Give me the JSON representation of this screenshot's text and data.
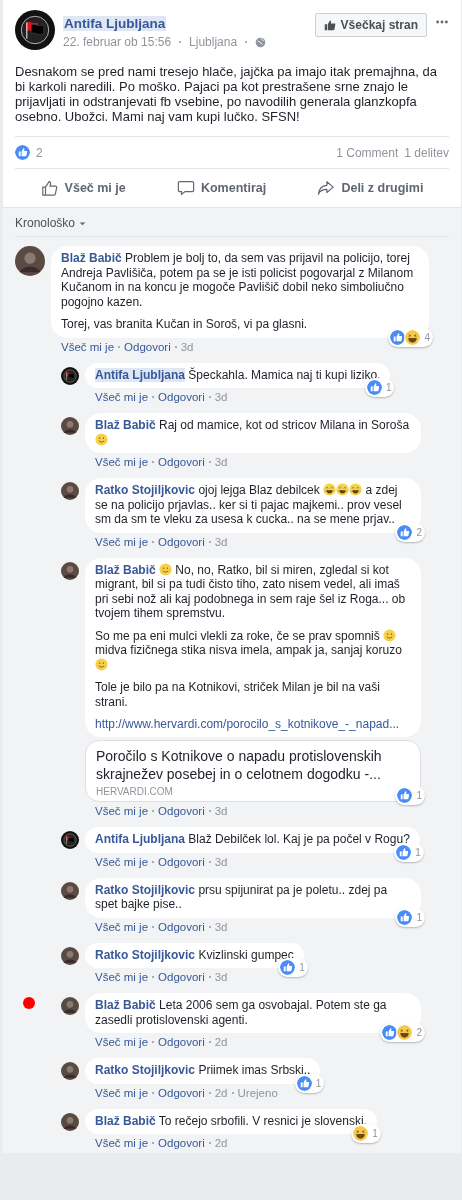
{
  "post": {
    "author": "Antifa Ljubljana",
    "author_highlighted": true,
    "date": "22. februar ob 15:56",
    "location": "Ljubljana",
    "like_page_button": "Všečkaj stran",
    "text": "Desnakom se pred nami tresejo hlače, jajčka pa imajo itak premajhna, da bi karkoli naredili. Po moško. Pajaci pa kot prestrašene srne znajo le prijavljati in odstranjevati fb vsebine, po navodilih generala glanzkopfa osebno. Ubožci. Mami naj vam kupi lučko. SFSN!",
    "reaction_count": "2",
    "comments_count": "1 Comment",
    "shares_count": "1 delitev",
    "actions": [
      {
        "kind": "like",
        "label": "Všeč mi je"
      },
      {
        "kind": "comment",
        "label": "Komentiraj"
      },
      {
        "kind": "share",
        "label": "Deli z drugimi"
      }
    ],
    "sort_label": "Kronološko"
  },
  "comments": [
    {
      "author": "Blaž Babič",
      "avatar": {
        "kind": "photo"
      },
      "paragraphs": [
        [
          {
            "kind": "text",
            "text": "Problem je bolj to, da sem vas prijavil na policijo, torej Andreja Pavlišiča, potem pa se je isti policist pogovarjal z Milanom Kučanom in na koncu je mogoče Pavlišič dobil neko simboliučno pogojno kazen."
          }
        ],
        [
          {
            "kind": "text",
            "text": "Torej, vas branita Kučan in Soroš, vi pa glasni."
          }
        ]
      ],
      "reactions": {
        "types": [
          {
            "kind": "like"
          },
          {
            "kind": "haha"
          }
        ],
        "count": "4"
      },
      "like_label": "Všeč mi je",
      "reply_label": "Odgovori",
      "time": "3d",
      "replies": [
        {
          "author": "Antifa Ljubljana",
          "author_highlighted": true,
          "avatar": {
            "kind": "antifa"
          },
          "paragraphs": [
            [
              {
                "kind": "text",
                "text": "Špeckahla. Mamica naj ti kupi liziko."
              }
            ]
          ],
          "reactions": {
            "types": [
              {
                "kind": "like"
              }
            ],
            "count": "1"
          },
          "like_label": "Všeč mi je",
          "reply_label": "Odgovori",
          "time": "3d"
        },
        {
          "author": "Blaž Babič",
          "avatar": {
            "kind": "photo"
          },
          "paragraphs": [
            [
              {
                "kind": "text",
                "text": "Raj od mamice, kot od stricov Milana in Soroša "
              },
              {
                "kind": "smile"
              }
            ]
          ],
          "like_label": "Všeč mi je",
          "reply_label": "Odgovori",
          "time": "3d"
        },
        {
          "author": "Ratko Stojiljkovic",
          "avatar": {
            "kind": "photo"
          },
          "paragraphs": [
            [
              {
                "kind": "text",
                "text": "ojoj lejga Blaz debilcek "
              },
              {
                "kind": "joy"
              },
              {
                "kind": "joy"
              },
              {
                "kind": "joy"
              },
              {
                "kind": "text",
                "text": " a zdej se na policijo prjavlas.. ker si ti pajac majkemi.. prov vesel sm da sm te vleku za usesa k cucka.. na se mene prjav.."
              }
            ]
          ],
          "reactions": {
            "types": [
              {
                "kind": "like"
              }
            ],
            "count": "2"
          },
          "like_label": "Všeč mi je",
          "reply_label": "Odgovori",
          "time": "3d"
        },
        {
          "author": "Blaž Babič",
          "avatar": {
            "kind": "photo"
          },
          "paragraphs": [
            [
              {
                "kind": "smile"
              },
              {
                "kind": "text",
                "text": " No, no, Ratko, bil si miren, zgledal si kot migrant, bil si pa tudi čisto tiho, zato nisem vedel, ali imaš pri sebi nož ali kaj podobnega in sem raje šel iz Roga... ob tvojem tihem spremstvu."
              }
            ],
            [
              {
                "kind": "text",
                "text": "So me pa eni mulci vlekli za roke, če se prav spomniš "
              },
              {
                "kind": "smile"
              },
              {
                "kind": "text",
                "text": " midva fizičnega stika nisva imela, ampak ja, sanjaj koruzo "
              },
              {
                "kind": "smile"
              }
            ],
            [
              {
                "kind": "text",
                "text": "Tole je bilo pa na Kotnikovi, striček Milan je bil na vaši strani."
              }
            ]
          ],
          "link": "http://www.hervardi.com/porocilo_s_kotnikove_-_napad...",
          "preview": {
            "title": "Poročilo s Kotnikove o napadu protislovenskih skrajnežev posebej in o celotnem dogodku -...",
            "domain": "HERVARDI.COM"
          },
          "reactions": {
            "types": [
              {
                "kind": "like"
              }
            ],
            "count": "1"
          },
          "like_label": "Všeč mi je",
          "reply_label": "Odgovori",
          "time": "3d"
        },
        {
          "author": "Antifa Ljubljana",
          "avatar": {
            "kind": "antifa"
          },
          "paragraphs": [
            [
              {
                "kind": "text",
                "text": "Blaž Debilček lol. Kaj je pa počel v Rogu?"
              }
            ]
          ],
          "reactions": {
            "types": [
              {
                "kind": "like"
              }
            ],
            "count": "1"
          },
          "like_label": "Všeč mi je",
          "reply_label": "Odgovori",
          "time": "3d"
        },
        {
          "author": "Ratko Stojiljkovic",
          "avatar": {
            "kind": "photo"
          },
          "paragraphs": [
            [
              {
                "kind": "text",
                "text": "prsu spijunirat pa je poletu.. zdej pa spet bajke pise.."
              }
            ]
          ],
          "reactions": {
            "types": [
              {
                "kind": "like"
              }
            ],
            "count": "1"
          },
          "like_label": "Všeč mi je",
          "reply_label": "Odgovori",
          "time": "3d"
        },
        {
          "author": "Ratko Stojiljkovic",
          "avatar": {
            "kind": "photo"
          },
          "paragraphs": [
            [
              {
                "kind": "text",
                "text": "Kvizlinski gumpec"
              }
            ]
          ],
          "reactions": {
            "types": [
              {
                "kind": "like"
              }
            ],
            "count": "1"
          },
          "like_label": "Všeč mi je",
          "reply_label": "Odgovori",
          "time": "3d"
        },
        {
          "author": "Blaž Babič",
          "avatar": {
            "kind": "photo"
          },
          "marked": true,
          "paragraphs": [
            [
              {
                "kind": "text",
                "text": "Leta 2006 sem ga osvobajal. Potem ste ga zasedli protislovenski agenti."
              }
            ]
          ],
          "reactions": {
            "types": [
              {
                "kind": "like"
              },
              {
                "kind": "haha"
              }
            ],
            "count": "2"
          },
          "like_label": "Všeč mi je",
          "reply_label": "Odgovori",
          "time": "2d"
        },
        {
          "author": "Ratko Stojiljkovic",
          "avatar": {
            "kind": "photo"
          },
          "paragraphs": [
            [
              {
                "kind": "text",
                "text": "Priimek imas Srbski.."
              }
            ]
          ],
          "reactions": {
            "types": [
              {
                "kind": "like"
              }
            ],
            "count": "1"
          },
          "like_label": "Všeč mi je",
          "reply_label": "Odgovori",
          "time": "2d",
          "edited": "Urejeno"
        },
        {
          "author": "Blaž Babič",
          "avatar": {
            "kind": "photo"
          },
          "paragraphs": [
            [
              {
                "kind": "text",
                "text": "To rečejo srbofili. V resnici je slovenski."
              }
            ]
          ],
          "reactions": {
            "types": [
              {
                "kind": "haha"
              }
            ],
            "count": "1"
          },
          "like_label": "Všeč mi je",
          "reply_label": "Odgovori",
          "time": "2d"
        }
      ]
    }
  ]
}
